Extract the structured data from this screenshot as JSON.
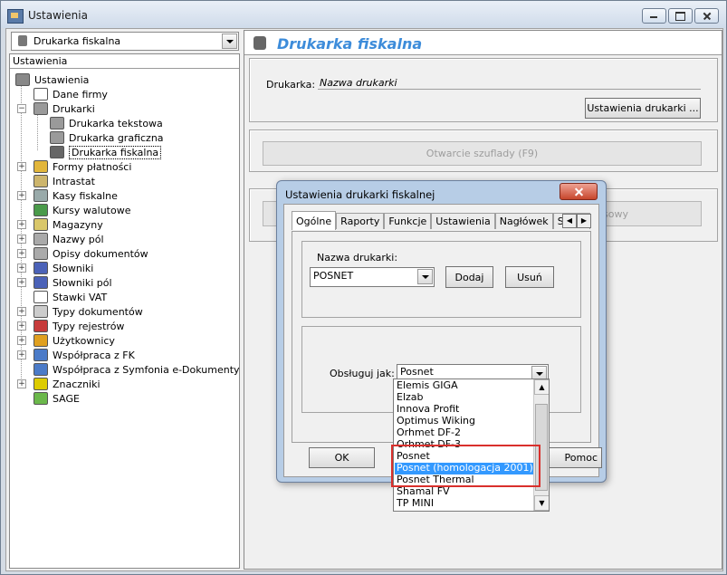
{
  "window": {
    "title": "Ustawienia"
  },
  "left": {
    "combo_value": "Drukarka fiskalna",
    "header": "Ustawienia",
    "tree": [
      {
        "label": "Ustawienia",
        "icon": "settings-icon"
      },
      {
        "label": "Dane firmy",
        "icon": "company-icon"
      },
      {
        "label": "Drukarki",
        "icon": "printer-icon"
      },
      {
        "label": "Drukarka tekstowa",
        "icon": "printer-icon"
      },
      {
        "label": "Drukarka graficzna",
        "icon": "printer-icon"
      },
      {
        "label": "Drukarka fiskalna",
        "icon": "fiscal-printer-icon",
        "selected": true
      },
      {
        "label": "Formy płatności",
        "icon": "payment-icon"
      },
      {
        "label": "Intrastat",
        "icon": "intrastat-icon"
      },
      {
        "label": "Kasy fiskalne",
        "icon": "cash-register-icon"
      },
      {
        "label": "Kursy walutowe",
        "icon": "currency-icon"
      },
      {
        "label": "Magazyny",
        "icon": "warehouse-icon"
      },
      {
        "label": "Nazwy pól",
        "icon": "fields-icon"
      },
      {
        "label": "Opisy dokumentów",
        "icon": "document-icon"
      },
      {
        "label": "Słowniki",
        "icon": "dictionary-icon"
      },
      {
        "label": "Słowniki pól",
        "icon": "dictionary-icon"
      },
      {
        "label": "Stawki VAT",
        "icon": "vat-icon"
      },
      {
        "label": "Typy dokumentów",
        "icon": "document-types-icon"
      },
      {
        "label": "Typy rejestrów",
        "icon": "register-icon"
      },
      {
        "label": "Użytkownicy",
        "icon": "users-icon"
      },
      {
        "label": "Współpraca z FK",
        "icon": "cooperation-icon"
      },
      {
        "label": "Współpraca z Symfonia e-Dokumenty",
        "icon": "cooperation-icon"
      },
      {
        "label": "Znaczniki",
        "icon": "markers-icon"
      },
      {
        "label": "SAGE",
        "icon": "sage-icon"
      }
    ]
  },
  "right": {
    "title": "Drukarka fiskalna",
    "printer_label": "Drukarka:",
    "printer_name": "Nazwa drukarki",
    "settings_button": "Ustawienia drukarki ...",
    "drawer_button": "Otwarcie szuflady (F9)",
    "hidden_button_fragment": "sowy"
  },
  "dialog": {
    "title": "Ustawienia drukarki fiskalnej",
    "tabs": [
      "Ogólne",
      "Raporty",
      "Funkcje",
      "Ustawienia",
      "Nagłówek",
      "Stopk"
    ],
    "name_label": "Nazwa drukarki:",
    "name_value": "POSNET",
    "add_button": "Dodaj",
    "remove_button": "Usuń",
    "handle_label": "Obsługuj jak:",
    "handle_value": "Posnet",
    "ok_button": "OK",
    "help_button_fragment": "Pomoc",
    "options": [
      "Elemis GIGA",
      "Elzab",
      "Innova Profit",
      "Optimus Wiking",
      "Orhmet DF-2",
      "Orhmet DF-3",
      "Posnet",
      "Posnet (homologacja 2001)",
      "Posnet Thermal",
      "Shamal FV",
      "TP MINI"
    ],
    "selected_option": "Posnet (homologacja 2001)"
  }
}
